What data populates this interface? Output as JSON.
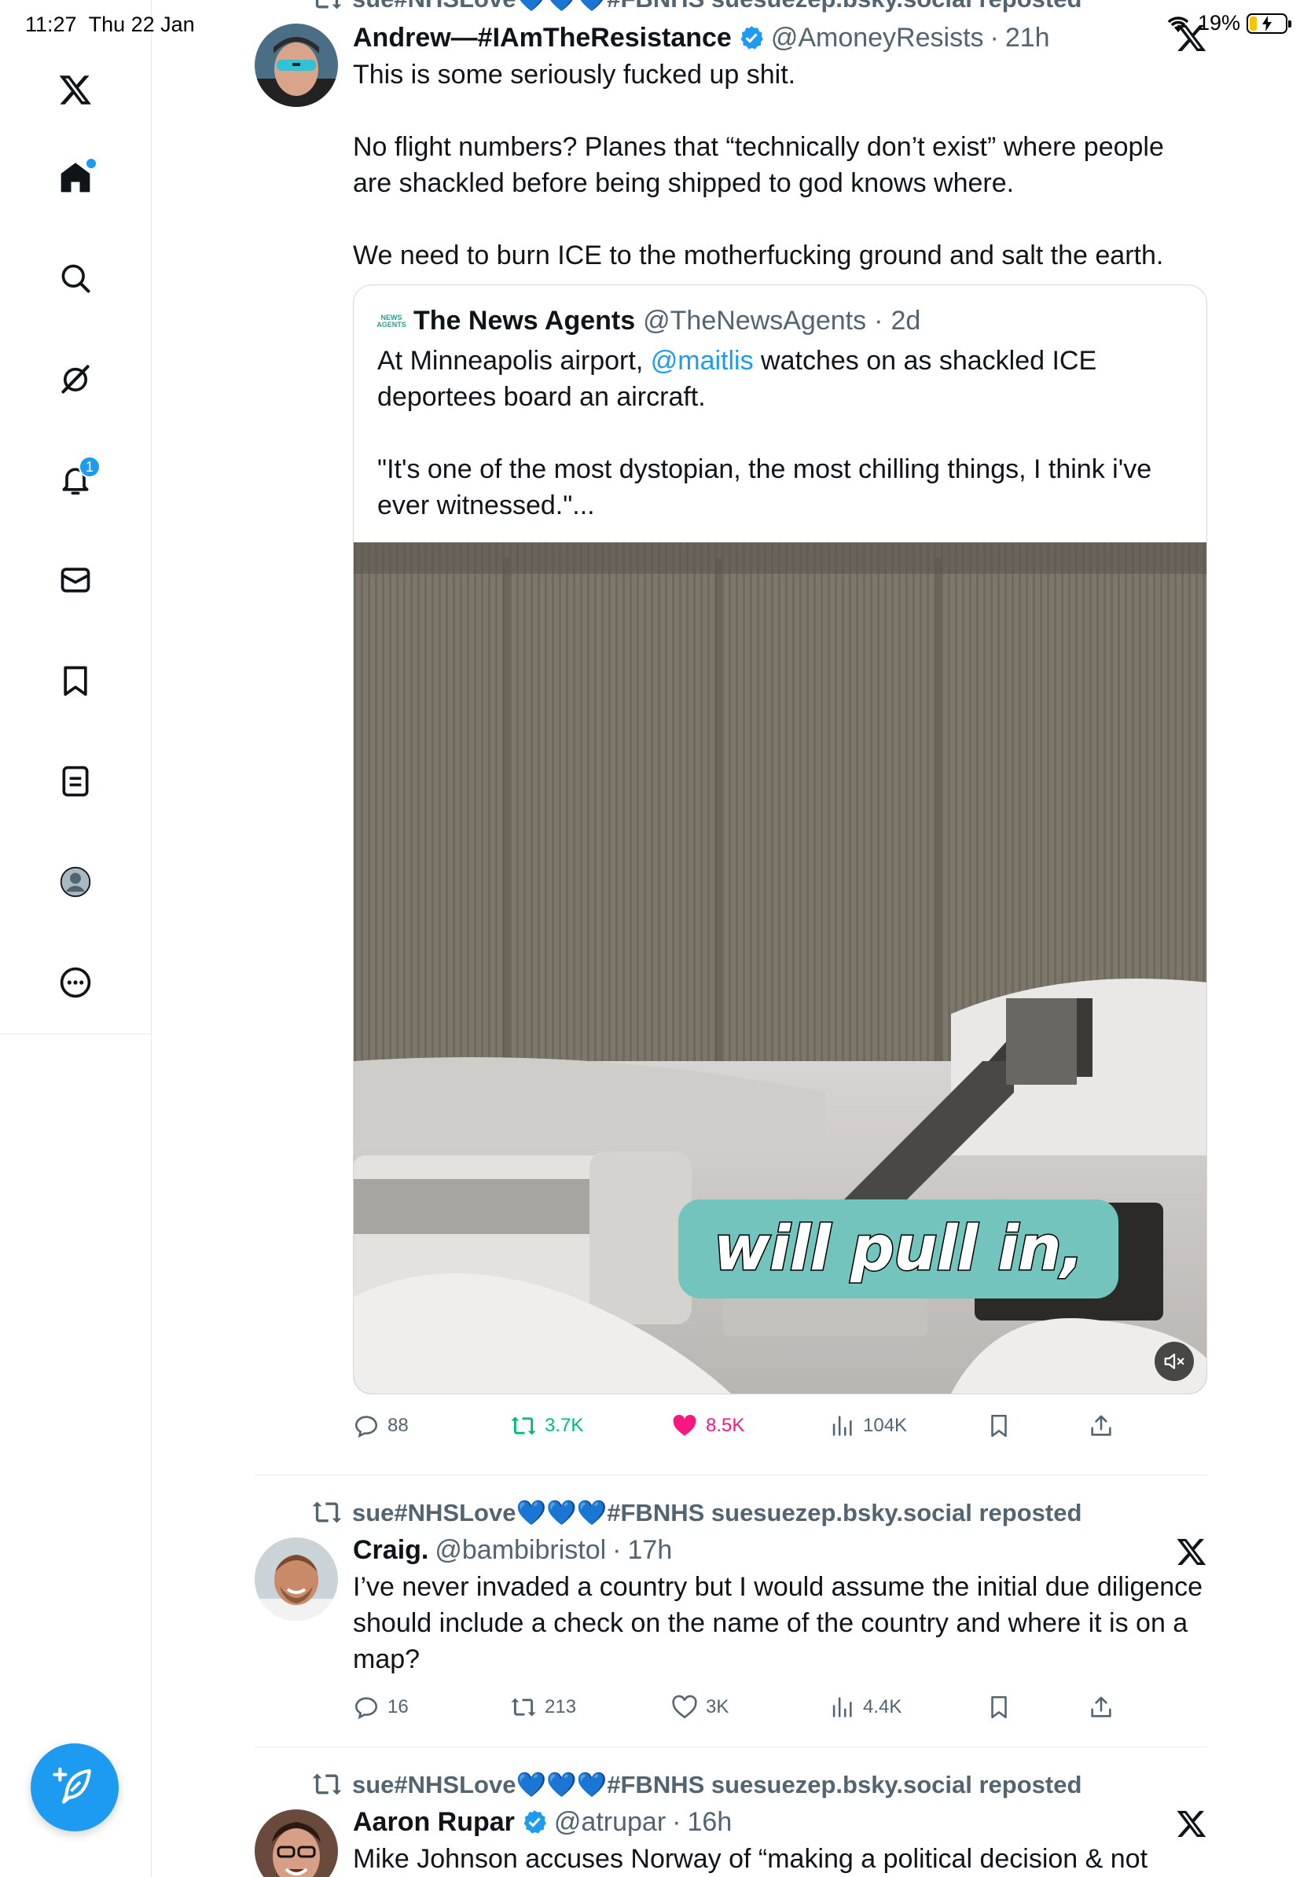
{
  "status_bar": {
    "time": "11:27",
    "date": "Thu 22 Jan",
    "battery": "19%"
  },
  "sidebar": {
    "items": [
      {
        "name": "x-logo",
        "icon": "x-logo-icon"
      },
      {
        "name": "home",
        "icon": "home-icon"
      },
      {
        "name": "explore",
        "icon": "search-icon"
      },
      {
        "name": "grok",
        "icon": "grok-icon"
      },
      {
        "name": "notifications",
        "icon": "bell-icon",
        "badge": "1"
      },
      {
        "name": "messages",
        "icon": "mail-icon"
      },
      {
        "name": "bookmarks",
        "icon": "bookmark-icon"
      },
      {
        "name": "lists",
        "icon": "list-icon"
      },
      {
        "name": "profile",
        "icon": "avatar-icon"
      },
      {
        "name": "more",
        "icon": "more-icon"
      }
    ],
    "compose_icon": "compose-icon"
  },
  "partial_repost_line": "sue#NHSLove💙💙💙#FBNHS suesuezep.bsky.social reposted",
  "tweets": [
    {
      "name": "Andrew—#IAmTheResistance",
      "handle": "@AmoneyResists",
      "time": "21h",
      "text": [
        "This is some seriously fucked up shit.",
        "No flight numbers? Planes that “technically don’t exist” where people are shackled before being shipped to god knows where.",
        "We need to burn ICE to the motherfucking ground and salt the earth."
      ],
      "quote": {
        "name": "The News Agents",
        "handle": "@TheNewsAgents",
        "time": "2d",
        "avatar_text": [
          "NEWS",
          "AGENTS"
        ],
        "text_before_mention": "At Minneapolis airport, ",
        "mention": "@maitlis",
        "text_after_mention": " watches on as shackled ICE deportees board an aircraft.",
        "text_2": "\"It's one of the most dystopian, the most chilling things, I think i've ever witnessed.\"...",
        "video_caption": "will pull in,"
      },
      "actions": {
        "replies": "88",
        "reposts": "3.7K",
        "likes": "8.5K",
        "views": "104K"
      }
    },
    {
      "repost_by": "sue#NHSLove💙💙💙#FBNHS suesuezep.bsky.social reposted",
      "name": "Craig.",
      "handle": "@bambibristol",
      "time": "17h",
      "text": "I’ve never invaded a country but I would assume the initial due diligence should include a check on the name of the country and where it is on a map?",
      "actions": {
        "replies": "16",
        "reposts": "213",
        "likes": "3K",
        "views": "4.4K"
      }
    },
    {
      "repost_by": "sue#NHSLove💙💙💙#FBNHS suesuezep.bsky.social reposted",
      "name": "Aaron Rupar",
      "handle": "@atrupar",
      "time": "16h",
      "text": "Mike Johnson accuses Norway of “making a political decision & not"
    }
  ],
  "colors": {
    "accent": "#1d9bf0",
    "repost_green": "#00ba7c",
    "like_pink": "#f91880",
    "muted_text": "#536471",
    "caption_bg": "#72c4bc"
  }
}
